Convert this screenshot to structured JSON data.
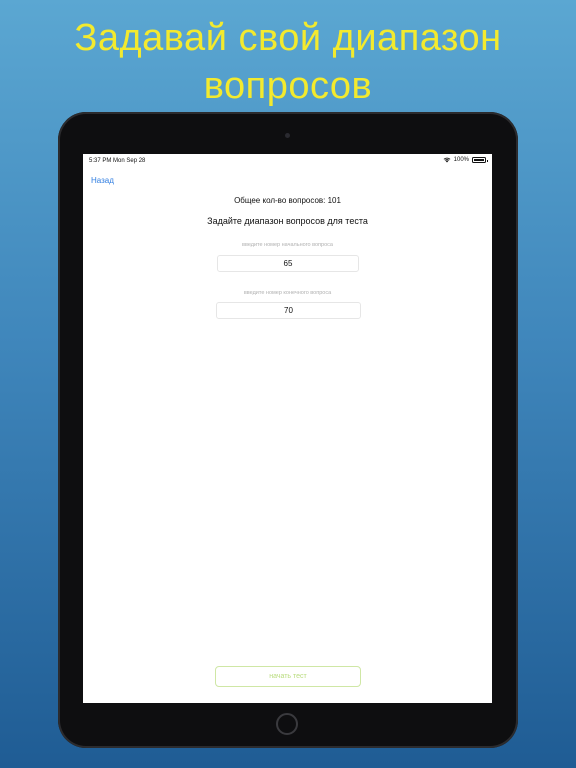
{
  "promo": {
    "line1": "Задавай свой диапазон",
    "line2": "вопросов"
  },
  "status": {
    "time_date": "5:37 PM   Mon Sep 28",
    "battery_pct": "100%",
    "icons": [
      "wifi-icon",
      "battery-icon"
    ]
  },
  "nav": {
    "back_label": "Назад"
  },
  "main": {
    "total_label": "Общее кол-во вопросов: 101",
    "range_title": "Задайте диапазон вопросов для теста",
    "start_field": {
      "placeholder": "введите номер начального вопроса",
      "value": "65"
    },
    "end_field": {
      "placeholder": "введите номер конечного вопроса",
      "value": "70"
    },
    "start_button_label": "начать тест"
  },
  "colors": {
    "headline": "#f3ea2e",
    "link": "#2f7de1",
    "button_text": "#b9dc7e",
    "button_border": "#cfe7a5"
  }
}
